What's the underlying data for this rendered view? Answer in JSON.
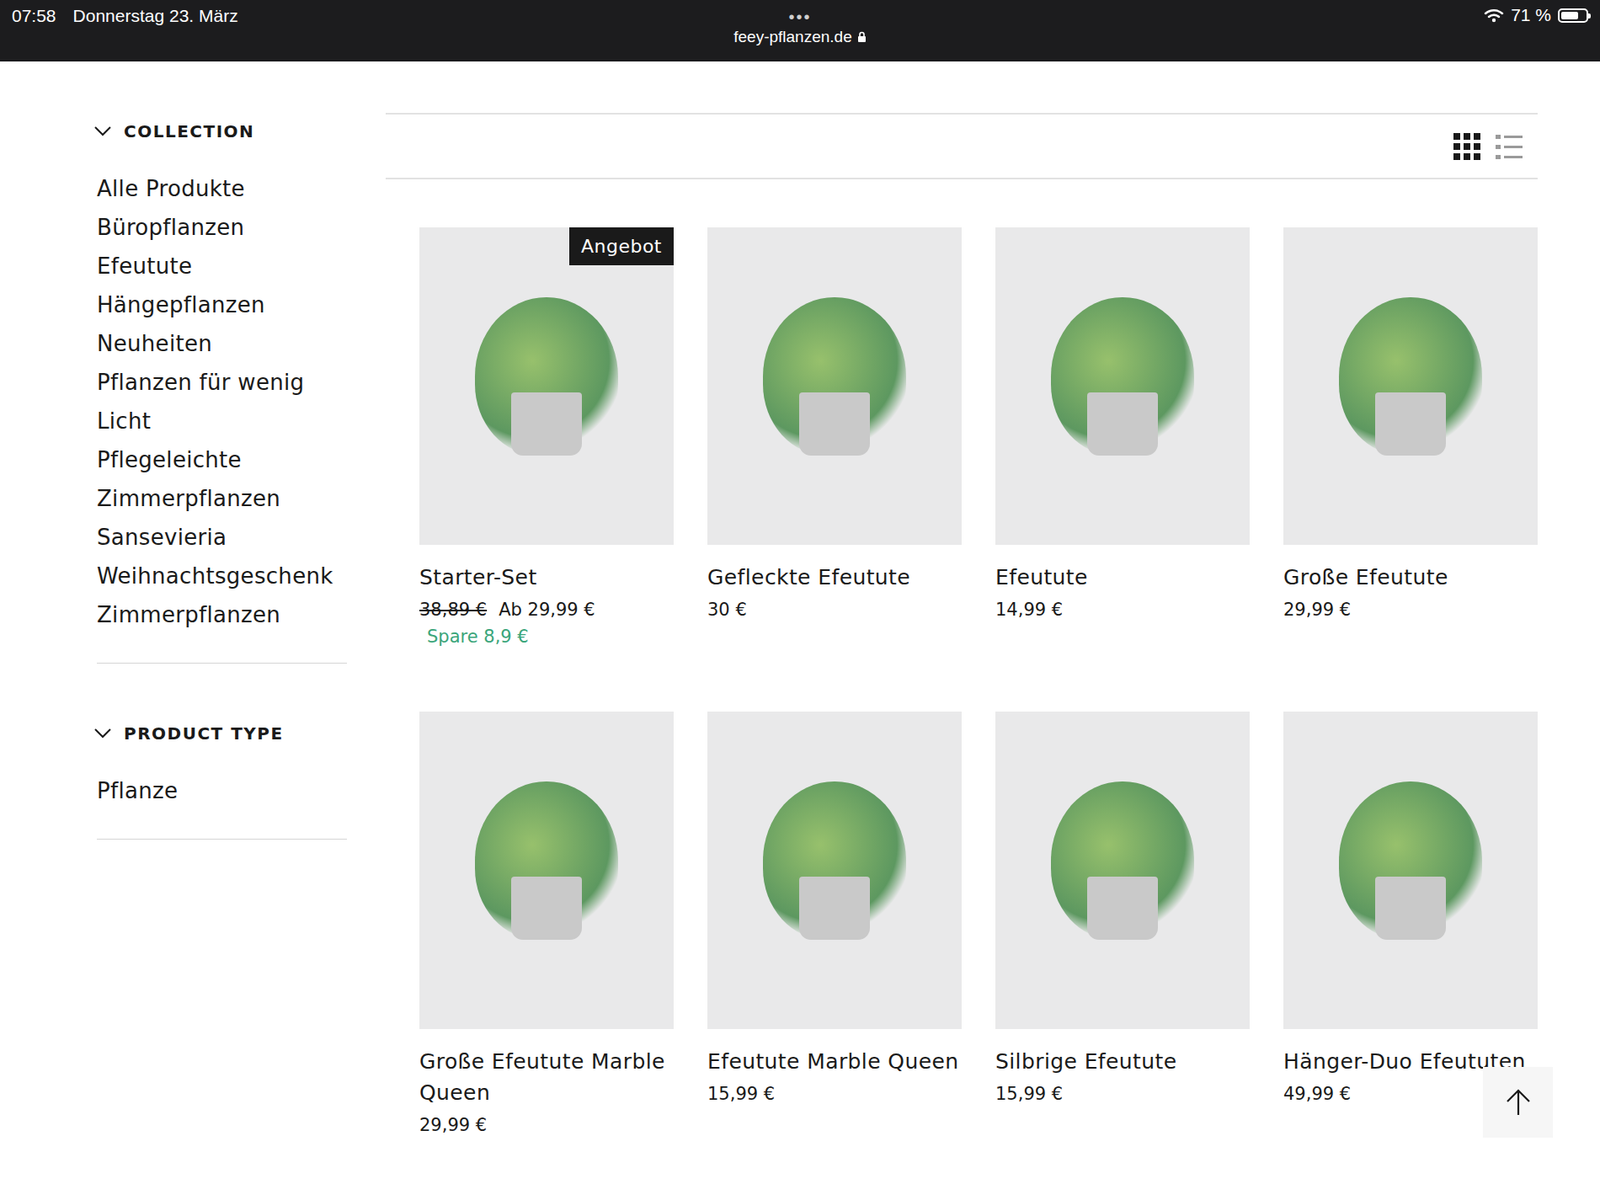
{
  "status_bar": {
    "time": "07:58",
    "date": "Donnerstag 23. März",
    "dots": "•••",
    "url": "feey-pflanzen.de",
    "battery": "71 %",
    "battery_level": 0.71
  },
  "sidebar": {
    "sections": [
      {
        "title": "COLLECTION",
        "expanded": true,
        "items": [
          "Alle Produkte",
          "Büropflanzen",
          "Efeutute",
          "Hängepflanzen",
          "Neuheiten",
          "Pflanzen für wenig",
          "Licht",
          "Pflegeleichte",
          "Zimmerpflanzen",
          "Sansevieria",
          "Weihnachtsgeschenk",
          "Zimmerpflanzen"
        ]
      },
      {
        "title": "PRODUCT TYPE",
        "expanded": true,
        "items": [
          "Pflanze"
        ]
      }
    ]
  },
  "toolbar": {
    "views": [
      {
        "kind": "grid",
        "selected": true
      },
      {
        "kind": "list",
        "selected": false
      }
    ]
  },
  "products": [
    {
      "title": "Starter-Set",
      "old_price": "38,89 €",
      "price": "Ab 29,99 €",
      "saving": "Spare 8,9 €",
      "badge": "Angebot"
    },
    {
      "title": "Gefleckte Efeutute",
      "price": "30 €"
    },
    {
      "title": "Efeutute",
      "price": "14,99 €"
    },
    {
      "title": "Große Efeutute",
      "price": "29,99 €"
    },
    {
      "title": "Große Efeutute Marble Queen",
      "price": "29,99 €"
    },
    {
      "title": "Efeutute Marble Queen",
      "price": "15,99 €"
    },
    {
      "title": "Silbrige Efeutute",
      "price": "15,99 €"
    },
    {
      "title": "Hänger-Duo Efeututen",
      "price": "49,99 €"
    }
  ]
}
